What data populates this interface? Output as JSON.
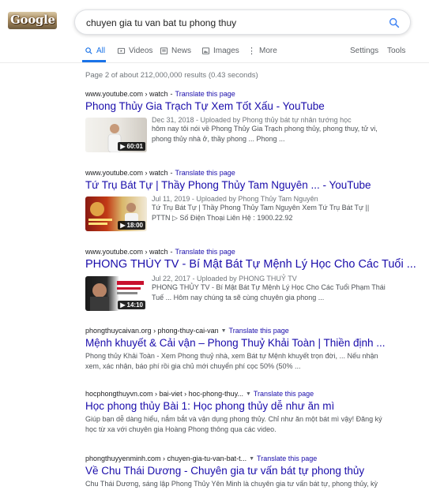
{
  "logo": {
    "text": "Google"
  },
  "search": {
    "query": "chuyen gia tu van bat tu phong thuy"
  },
  "tabs": {
    "all": "All",
    "videos": "Videos",
    "news": "News",
    "images": "Images",
    "more": "More",
    "settings": "Settings",
    "tools": "Tools"
  },
  "stats": "Page 2 of about 212,000,000 results (0.43 seconds)",
  "translate_label": "Translate this page",
  "results": [
    {
      "crumb": "www.youtube.com › watch",
      "title": "Phong Thủy Gia Trạch Tự Xem Tốt Xấu - YouTube",
      "uploaded": "Dec 31, 2018 - Uploaded by Phong thủy bát tự nhân tướng học",
      "snippet_line1": "hôm nay tôi nói về Phong Thủy Gia Trạch phong thủy, phong thuy, tử vi,",
      "snippet_line2": "phong thủy nhà ở, thầy phong ... Phong ...",
      "duration": "60:01"
    },
    {
      "crumb": "www.youtube.com › watch",
      "title": "Tứ Trụ Bát Tự | Thầy Phong Thủy Tam Nguyên ... - YouTube",
      "uploaded": "Jul 11, 2019 - Uploaded by Phong Thủy Tam Nguyên",
      "snippet_line1": "Tứ Trụ Bát Tự | Thầy Phong Thủy Tam Nguyên Xem Tứ Trụ Bát Tự ||",
      "snippet_line2": "PTTN ▷ Số Điện Thoại Liên Hệ : 1900.22.92",
      "duration": "18:00"
    },
    {
      "crumb": "www.youtube.com › watch",
      "title": "PHONG THỦY TV - Bí Mật Bát Tự Mệnh Lý Học Cho Các Tuổi ...",
      "uploaded": "Jul 22, 2017 - Uploaded by PHONG THUỶ TV",
      "snippet_line1": "PHONG THỦY TV - Bí Mật Bát Tự Mệnh Lý Học Cho Các Tuổi Phạm Thái",
      "snippet_line2": "Tuế ... Hôm nay chúng ta sẽ cùng chuyên gia phong ...",
      "duration": "14:10"
    },
    {
      "crumb": "phongthuycaivan.org › phong-thuy-cai-van",
      "title": "Mệnh khuyết & Cải vận – Phong Thuỷ Khải Toàn | Thiền định ...",
      "snippet_line1": "Phong thủy Khải Toàn - Xem Phong thuỷ nhà, xem Bát tự Mệnh khuyết trọn đời, ... Nếu nhận",
      "snippet_line2": "xem, xác nhận, báo phí rồi gia chủ mới chuyển phí cọc 50% (50% ..."
    },
    {
      "crumb": "hocphongthuyvn.com › bai-viet › hoc-phong-thuy...",
      "title": "Học phong thủy Bài 1: Học phong thủy dễ như ăn mì",
      "snippet_line1": "Giúp bạn dễ dàng hiểu, nắm bắt và vận dụng phong thủy. Chỉ như ăn một bát mì vậy! Đăng ký",
      "snippet_line2": "học từ xa với chuyên gia Hoàng Phong thông qua các video."
    },
    {
      "crumb": "phongthuyyenminh.com › chuyen-gia-tu-van-bat-t...",
      "title": "Về Chu Thái Dương - Chuyên gia tư vấn bát tự phong thủy",
      "snippet_line1": "Chu Thái Dương, sáng lập Phong Thủy Yên Minh là chuyên gia tư vấn bát tự, phong thủy, kỳ",
      "snippet_line2": ""
    }
  ]
}
